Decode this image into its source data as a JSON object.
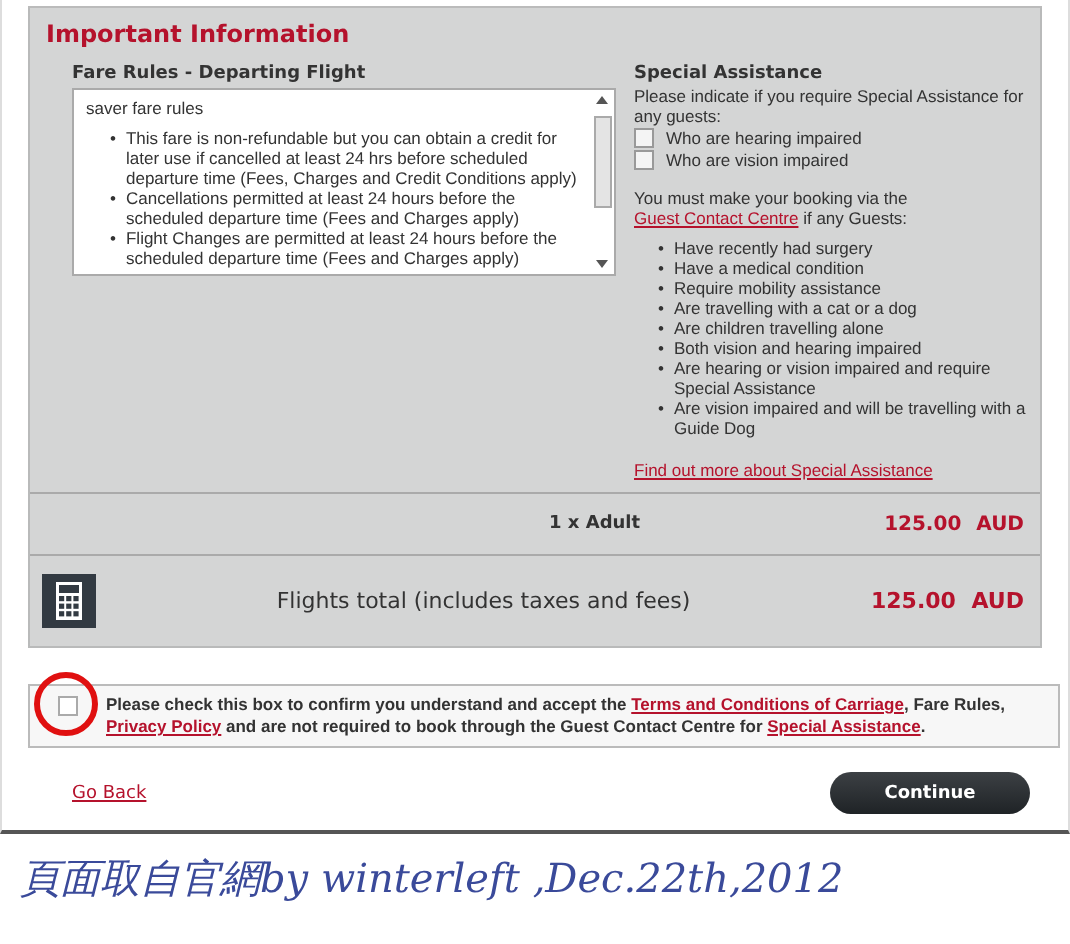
{
  "heading": "Important Information",
  "fare_rules": {
    "title": "Fare Rules - Departing Flight",
    "subtitle": "saver fare rules",
    "items": [
      {
        "marker": "•",
        "text": "This fare is non-refundable but you can obtain a credit for later use if cancelled at least 24 hrs before scheduled departure time (Fees, Charges and Credit Conditions apply)"
      },
      {
        "marker": "•",
        "text": "Cancellations permitted at least 24 hours before the scheduled departure time (Fees and Charges apply)"
      },
      {
        "marker": "•",
        "text": "Flight Changes are permitted at least 24 hours before the scheduled departure time (Fees and Charges apply)"
      }
    ]
  },
  "special_assistance": {
    "title": "Special Assistance",
    "intro": "Please indicate if you require Special Assistance for any guests:",
    "options": [
      {
        "label": "Who are hearing impaired",
        "checked": false
      },
      {
        "label": "Who are vision impaired",
        "checked": false
      }
    ],
    "notice": {
      "before": "You must make your booking via the",
      "link": "Guest Contact Centre",
      "after": "if any Guests:"
    },
    "conditions": [
      {
        "marker": "•",
        "text": "Have recently had surgery"
      },
      {
        "marker": "•",
        "text": "Have a medical condition"
      },
      {
        "marker": "•",
        "text": "Require mobility assistance"
      },
      {
        "marker": "•",
        "text": "Are travelling with a cat or a dog"
      },
      {
        "marker": "•",
        "text": "Are children travelling alone"
      },
      {
        "marker": "•",
        "text": "Both vision and hearing impaired"
      },
      {
        "marker": "•",
        "text": "Are hearing or vision impaired and require Special Assistance"
      },
      {
        "marker": "•",
        "text": "Are vision impaired and will be travelling with a Guide Dog"
      }
    ],
    "more_link": "Find out more about Special Assistance"
  },
  "summary": {
    "passenger": "1 x Adult",
    "passenger_price": "125.00 AUD",
    "total_label": "Flights total (includes taxes and fees)",
    "total_price": "125.00 AUD"
  },
  "consent": {
    "checked": false,
    "parts": [
      {
        "kind": "text",
        "text": "Please check this box to confirm you understand and accept the "
      },
      {
        "kind": "link",
        "text": "Terms and Conditions of Carriage"
      },
      {
        "kind": "text",
        "text": ", Fare Rules, "
      },
      {
        "kind": "link",
        "text": "Privacy Policy"
      },
      {
        "kind": "text",
        "text": " and are not required to book through the Guest Contact Centre for "
      },
      {
        "kind": "link",
        "text": "Special Assistance"
      },
      {
        "kind": "text",
        "text": "."
      }
    ]
  },
  "actions": {
    "back": "Go Back",
    "continue": "Continue"
  },
  "caption": "頁面取自官網by winterleft ,Dec.22th,2012"
}
